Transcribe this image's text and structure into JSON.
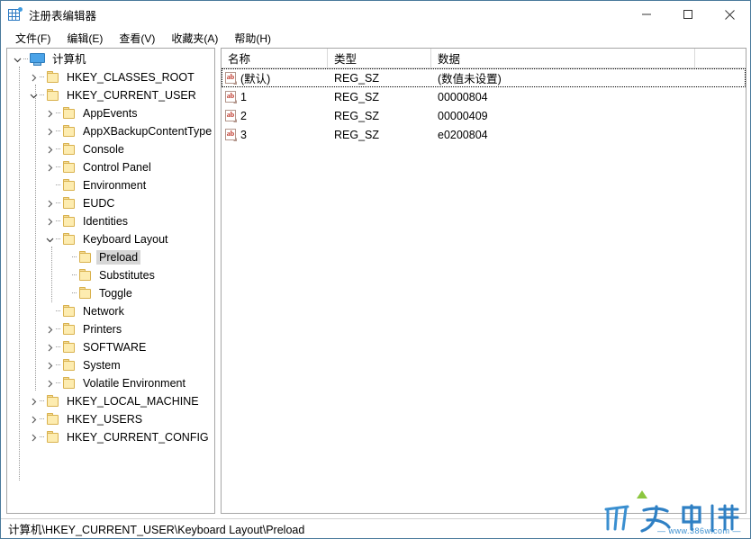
{
  "window": {
    "title": "注册表编辑器",
    "icon": "registry-editor-icon",
    "controls": {
      "minimize": "–",
      "maximize": "□",
      "close": "✕"
    }
  },
  "menubar": {
    "items": [
      {
        "label": "文件(F)"
      },
      {
        "label": "编辑(E)"
      },
      {
        "label": "查看(V)"
      },
      {
        "label": "收藏夹(A)"
      },
      {
        "label": "帮助(H)"
      }
    ]
  },
  "tree": {
    "items": [
      {
        "label": "计算机",
        "level": 0,
        "expander": "expanded",
        "icon": "computer-icon",
        "selected": false
      },
      {
        "label": "HKEY_CLASSES_ROOT",
        "level": 1,
        "expander": "collapsed",
        "icon": "folder-icon",
        "selected": false
      },
      {
        "label": "HKEY_CURRENT_USER",
        "level": 1,
        "expander": "expanded",
        "icon": "folder-icon",
        "selected": false
      },
      {
        "label": "AppEvents",
        "level": 2,
        "expander": "collapsed",
        "icon": "folder-icon",
        "selected": false
      },
      {
        "label": "AppXBackupContentType",
        "level": 2,
        "expander": "collapsed",
        "icon": "folder-icon",
        "selected": false
      },
      {
        "label": "Console",
        "level": 2,
        "expander": "collapsed",
        "icon": "folder-icon",
        "selected": false
      },
      {
        "label": "Control Panel",
        "level": 2,
        "expander": "collapsed",
        "icon": "folder-icon",
        "selected": false
      },
      {
        "label": "Environment",
        "level": 2,
        "expander": "none",
        "icon": "folder-icon",
        "selected": false
      },
      {
        "label": "EUDC",
        "level": 2,
        "expander": "collapsed",
        "icon": "folder-icon",
        "selected": false
      },
      {
        "label": "Identities",
        "level": 2,
        "expander": "collapsed",
        "icon": "folder-icon",
        "selected": false
      },
      {
        "label": "Keyboard Layout",
        "level": 2,
        "expander": "expanded",
        "icon": "folder-icon",
        "selected": false
      },
      {
        "label": "Preload",
        "level": 3,
        "expander": "none",
        "icon": "folder-icon",
        "selected": true
      },
      {
        "label": "Substitutes",
        "level": 3,
        "expander": "none",
        "icon": "folder-icon",
        "selected": false
      },
      {
        "label": "Toggle",
        "level": 3,
        "expander": "none",
        "icon": "folder-icon",
        "selected": false
      },
      {
        "label": "Network",
        "level": 2,
        "expander": "none",
        "icon": "folder-icon",
        "selected": false
      },
      {
        "label": "Printers",
        "level": 2,
        "expander": "collapsed",
        "icon": "folder-icon",
        "selected": false
      },
      {
        "label": "SOFTWARE",
        "level": 2,
        "expander": "collapsed",
        "icon": "folder-icon",
        "selected": false
      },
      {
        "label": "System",
        "level": 2,
        "expander": "collapsed",
        "icon": "folder-icon",
        "selected": false
      },
      {
        "label": "Volatile Environment",
        "level": 2,
        "expander": "collapsed",
        "icon": "folder-icon",
        "selected": false
      },
      {
        "label": "HKEY_LOCAL_MACHINE",
        "level": 1,
        "expander": "collapsed",
        "icon": "folder-icon",
        "selected": false
      },
      {
        "label": "HKEY_USERS",
        "level": 1,
        "expander": "collapsed",
        "icon": "folder-icon",
        "selected": false
      },
      {
        "label": "HKEY_CURRENT_CONFIG",
        "level": 1,
        "expander": "collapsed",
        "icon": "folder-icon",
        "selected": false
      }
    ]
  },
  "values": {
    "columns": [
      {
        "label": "名称"
      },
      {
        "label": "类型"
      },
      {
        "label": "数据"
      }
    ],
    "rows": [
      {
        "name": "(默认)",
        "type": "REG_SZ",
        "data": "(数值未设置)",
        "icon": "string-value-icon",
        "focused": true
      },
      {
        "name": "1",
        "type": "REG_SZ",
        "data": "00000804",
        "icon": "string-value-icon",
        "focused": false
      },
      {
        "name": "2",
        "type": "REG_SZ",
        "data": "00000409",
        "icon": "string-value-icon",
        "focused": false
      },
      {
        "name": "3",
        "type": "REG_SZ",
        "data": "e0200804",
        "icon": "string-value-icon",
        "focused": false
      }
    ]
  },
  "statusbar": {
    "path": "计算机\\HKEY_CURRENT_USER\\Keyboard Layout\\Preload"
  },
  "watermark": {
    "url": "— www.386w.com —"
  },
  "colors": {
    "window_border": "#4a7a9b",
    "selection": "#d6d6d6",
    "folder": "#fdecb0",
    "folder_edge": "#d9b24f",
    "computer_icon": "#4aa3e8",
    "watermark_blue": "#3a8fd0",
    "watermark_green": "#8cc63f"
  }
}
